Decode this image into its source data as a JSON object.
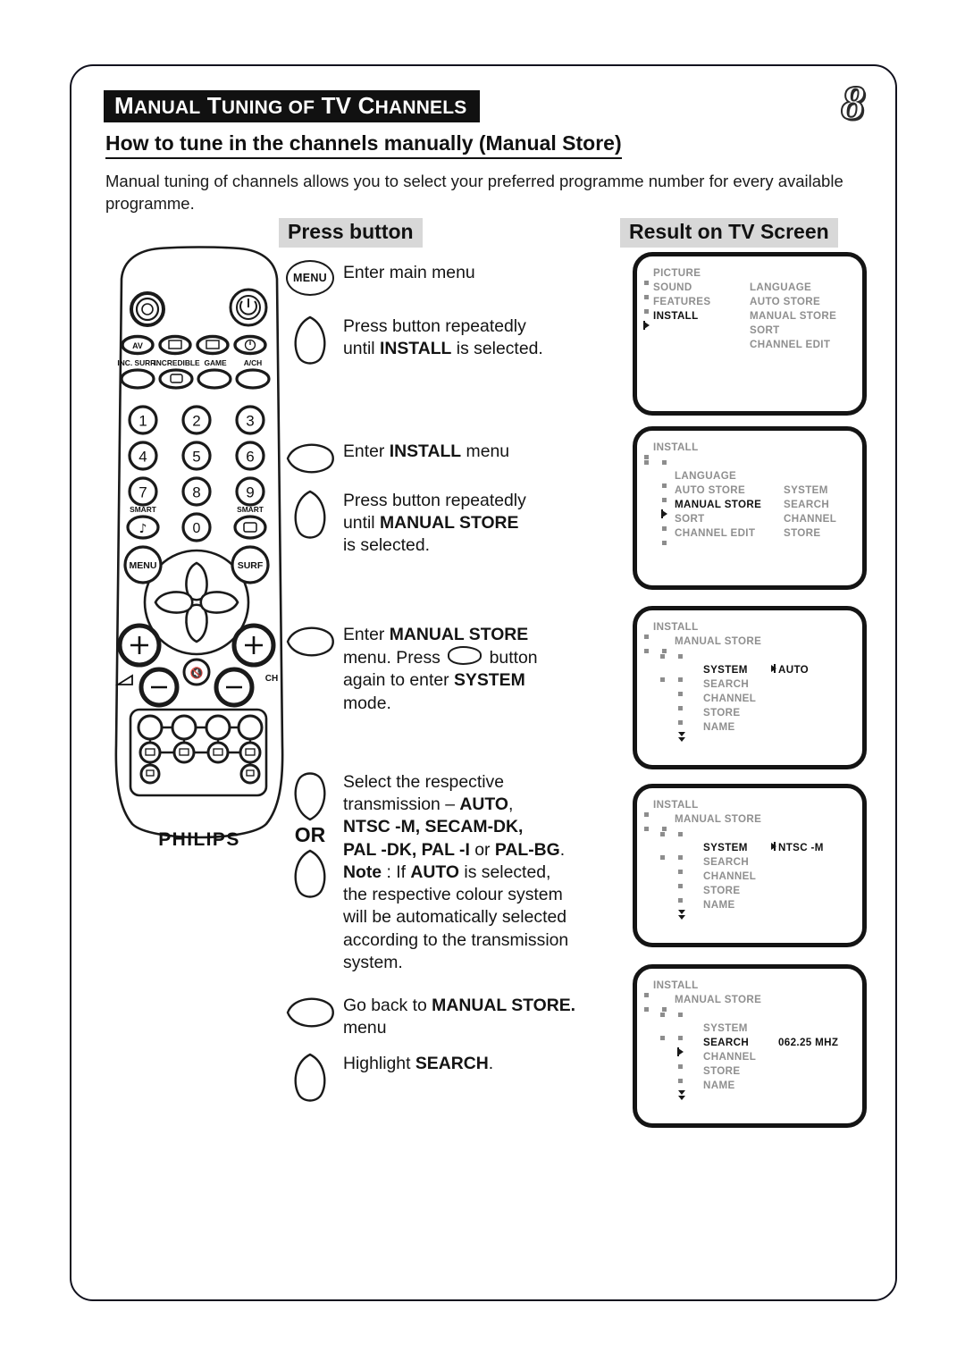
{
  "header": {
    "title_small_m": "M",
    "title_rest1": "ANUAL ",
    "title_t": "T",
    "title_rest2": "UNING OF ",
    "title_full": "MANUAL TUNING OF TV CHANNELS",
    "page_number": "8",
    "subtitle": "How to tune in the channels manually (Manual Store)",
    "intro": "Manual tuning of channels allows you to select your preferred programme number for every available programme."
  },
  "columns": {
    "press_button": "Press button",
    "result_on_tv": "Result on TV Screen"
  },
  "remote": {
    "brand": "PHILIPS",
    "menu_label": "MENU",
    "surf_label": "SURF",
    "ch_label": "CH",
    "row_labels": [
      "INC. SURR.",
      "INCREDIBLE",
      "GAME",
      "A/CH"
    ],
    "small_labels": [
      "AV",
      "⊞",
      "▭",
      "⏻"
    ],
    "smart_left": "SMART",
    "smart_right": "SMART",
    "digits": [
      "1",
      "2",
      "3",
      "4",
      "5",
      "6",
      "7",
      "8",
      "9",
      "0"
    ]
  },
  "steps": [
    {
      "id": "step-menu",
      "button": "menu-round",
      "button_label": "MENU",
      "text_html": "Enter main menu"
    },
    {
      "id": "step-down-install",
      "button": "down-teardrop",
      "text_html": "Press button repeatedly<br>until <b>INSTALL</b> is selected."
    },
    {
      "id": "step-right-install",
      "button": "right-teardrop",
      "text_html": "Enter <b>INSTALL</b> menu"
    },
    {
      "id": "step-down-manual-store",
      "button": "down-teardrop",
      "text_html": "Press button repeatedly<br>until <b>MANUAL STORE</b><br>is selected."
    },
    {
      "id": "step-right-manual-store",
      "button": "right-teardrop",
      "text_html": "Enter <b>MANUAL STORE</b><br>menu. Press <span class=\"inline-btn\" data-name=\"inline-right-button-icon\"></span> button<br>again to enter <b>SYSTEM</b><br>mode."
    },
    {
      "id": "step-select-system",
      "button": "up-down-or",
      "or_label": "OR",
      "text_html": "Select the respective<br>transmission – <b>AUTO</b>,<br><b>NTSC -M, SECAM-DK,</b><br><b>PAL -DK, PAL -I</b> or <b>PAL-BG</b>.<br><b>Note</b> : If <b>AUTO</b> is selected,<br>the respective colour system<br>will be automatically selected<br>according to the transmission<br>system."
    },
    {
      "id": "step-go-back",
      "button": "right-teardrop",
      "text_html": "Go back to <b>MANUAL STORE.</b><br>menu"
    },
    {
      "id": "step-highlight-search",
      "button": "down-teardrop",
      "text_html": "Highlight <b>SEARCH</b>."
    }
  ],
  "tv_screens": [
    {
      "id": "tv-main-menu",
      "rows": [
        {
          "markers": [
            "sq"
          ],
          "label": "PICTURE",
          "label_on": false
        },
        {
          "markers": [
            "sq"
          ],
          "label": "SOUND",
          "label_on": false,
          "col2": "LANGUAGE"
        },
        {
          "markers": [
            "sq"
          ],
          "label": "FEATURES",
          "label_on": false,
          "col2": "AUTO STORE"
        },
        {
          "markers": [
            "cur"
          ],
          "label": "INSTALL",
          "label_on": true,
          "col2": "MANUAL STORE"
        },
        {
          "markers": [],
          "label": "",
          "col2": "SORT"
        },
        {
          "markers": [],
          "label": "",
          "col2": "CHANNEL EDIT"
        }
      ]
    },
    {
      "id": "tv-install-menu",
      "rows": [
        {
          "markers": [
            "sq"
          ],
          "label": "INSTALL",
          "label_on": false
        },
        {
          "markers": [
            "sq",
            "sq"
          ],
          "label": "",
          "label_on": false
        },
        {
          "markers": [
            "blank",
            "sq"
          ],
          "label": "LANGUAGE",
          "label_on": false,
          "indent": 1
        },
        {
          "markers": [
            "blank",
            "sq"
          ],
          "label": "AUTO STORE",
          "label_on": false,
          "indent": 1,
          "col2": "SYSTEM"
        },
        {
          "markers": [
            "blank",
            "cur"
          ],
          "label": "MANUAL STORE",
          "label_on": true,
          "indent": 1,
          "col2": "SEARCH"
        },
        {
          "markers": [
            "blank",
            "sq"
          ],
          "label": "SORT",
          "label_on": false,
          "indent": 1,
          "col2": "CHANNEL"
        },
        {
          "markers": [
            "blank",
            "sq"
          ],
          "label": "CHANNEL EDIT",
          "label_on": false,
          "indent": 1,
          "col2": "STORE"
        }
      ]
    },
    {
      "id": "tv-system-auto",
      "rows": [
        {
          "markers": [
            "sq"
          ],
          "label": "INSTALL",
          "label_on": false
        },
        {
          "markers": [
            "sq",
            "sq"
          ],
          "label": "MANUAL STORE",
          "label_on": false
        },
        {
          "markers": [
            "blank",
            "sq",
            "sq"
          ],
          "label": "",
          "label_on": false
        },
        {
          "markers": [
            "blank",
            "sq",
            "sq"
          ],
          "label": "SYSTEM",
          "label_on": true,
          "indent": 2,
          "value": "AUTO",
          "value_cursor": true
        },
        {
          "markers": [
            "blank",
            "blank",
            "sq"
          ],
          "label": "SEARCH",
          "label_on": false,
          "indent": 2
        },
        {
          "markers": [
            "blank",
            "blank",
            "sq"
          ],
          "label": "CHANNEL",
          "label_on": false,
          "indent": 2
        },
        {
          "markers": [
            "blank",
            "blank",
            "sq"
          ],
          "label": "STORE",
          "label_on": false,
          "indent": 2
        },
        {
          "markers": [
            "blank",
            "blank",
            "dn"
          ],
          "label": "NAME",
          "label_on": false,
          "indent": 2
        }
      ]
    },
    {
      "id": "tv-system-ntsc",
      "rows": [
        {
          "markers": [
            "sq"
          ],
          "label": "INSTALL",
          "label_on": false
        },
        {
          "markers": [
            "sq",
            "sq"
          ],
          "label": "MANUAL STORE",
          "label_on": false
        },
        {
          "markers": [
            "blank",
            "sq",
            "sq"
          ],
          "label": "",
          "label_on": false
        },
        {
          "markers": [
            "blank",
            "sq",
            "sq"
          ],
          "label": "SYSTEM",
          "label_on": true,
          "indent": 2,
          "value": "NTSC -M",
          "value_cursor": true
        },
        {
          "markers": [
            "blank",
            "blank",
            "sq"
          ],
          "label": "SEARCH",
          "label_on": false,
          "indent": 2
        },
        {
          "markers": [
            "blank",
            "blank",
            "sq"
          ],
          "label": "CHANNEL",
          "label_on": false,
          "indent": 2
        },
        {
          "markers": [
            "blank",
            "blank",
            "sq"
          ],
          "label": "STORE",
          "label_on": false,
          "indent": 2
        },
        {
          "markers": [
            "blank",
            "blank",
            "dn"
          ],
          "label": "NAME",
          "label_on": false,
          "indent": 2
        }
      ]
    },
    {
      "id": "tv-search-freq",
      "rows": [
        {
          "markers": [
            "sq"
          ],
          "label": "INSTALL",
          "label_on": false
        },
        {
          "markers": [
            "sq",
            "sq"
          ],
          "label": "MANUAL STORE",
          "label_on": false
        },
        {
          "markers": [
            "blank",
            "sq",
            "sq"
          ],
          "label": "",
          "label_on": false
        },
        {
          "markers": [
            "blank",
            "sq",
            "sq"
          ],
          "label": "SYSTEM",
          "label_on": false,
          "indent": 2
        },
        {
          "markers": [
            "blank",
            "blank",
            "cur"
          ],
          "label": "SEARCH",
          "label_on": true,
          "indent": 2,
          "value": "062.25 MHZ",
          "value_cursor": false
        },
        {
          "markers": [
            "blank",
            "blank",
            "sq"
          ],
          "label": "CHANNEL",
          "label_on": false,
          "indent": 2
        },
        {
          "markers": [
            "blank",
            "blank",
            "sq"
          ],
          "label": "STORE",
          "label_on": false,
          "indent": 2
        },
        {
          "markers": [
            "blank",
            "blank",
            "dn"
          ],
          "label": "NAME",
          "label_on": false,
          "indent": 2
        }
      ]
    }
  ],
  "colors": {
    "ink": "#111111",
    "osd_dim": "#8f8f8f",
    "osd_bright": "#111111",
    "header_bg": "#111111",
    "colhdr_bg": "#d8d8d8"
  }
}
